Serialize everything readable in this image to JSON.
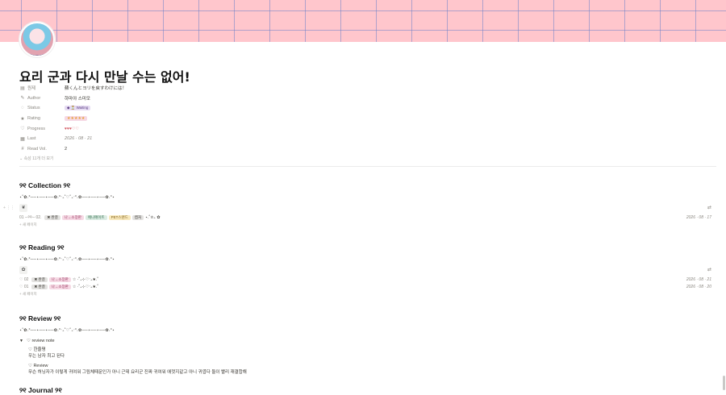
{
  "page": {
    "title": "요리 군과 다시 만날 수는 없어!",
    "properties": [
      {
        "icon": "text-icon",
        "glyph": "▤",
        "key": "원제",
        "value": "蘇くんとヨリを戻すわけには！"
      },
      {
        "icon": "person-icon",
        "glyph": "✎",
        "key": "Author",
        "value": "하마야 스미모"
      },
      {
        "icon": "status-icon",
        "glyph": "◌",
        "key": "Status",
        "tag": "◆ ⏳ Waiting"
      },
      {
        "icon": "star-icon",
        "glyph": "★",
        "key": "Rating",
        "tag": "★★★★★"
      },
      {
        "icon": "heart-icon",
        "glyph": "♡",
        "key": "Progress",
        "value": "♥♥♥♡♡"
      },
      {
        "icon": "calendar-icon",
        "glyph": "▦",
        "key": "Last",
        "value": "2026 · 08 · 21"
      },
      {
        "icon": "hash-icon",
        "glyph": "#",
        "key": "Read Vol.",
        "value": "2"
      }
    ],
    "more_props": "⌄ 속성 11개 더 보기"
  },
  "sections": {
    "collection": {
      "heading": "୨୧ Collection ୨୧",
      "divider": "⋆˚✿˖°──⋆──⋆──✿˖°‧₊˚♡˚₊‧°˖✿──⋆──⋆──✿˖°⋆",
      "view_icon": "❦",
      "view_ctl": "⇄",
      "rows": [
        {
          "name": "01 ─୨୧─ 02.",
          "tags": [
            [
              "✖ 완결",
              "t-gray"
            ],
            [
              "나→소장판",
              "t-pink"
            ],
            [
              "애니메이트",
              "t-green"
            ],
            [
              "PET스탠드",
              "t-yellow"
            ],
            [
              "캡처",
              "t-gray"
            ]
          ],
          "extra": "⋆.˚✮₊ ✿",
          "date": "2026 · 08 · 17"
        }
      ],
      "new": "+  새 페이지"
    },
    "reading": {
      "heading": "୨୧ Reading ୨୧",
      "divider": "⋆˚✿˖°──⋆──⋆──✿˖°‧₊˚♡˚₊‧°˖✿──⋆──⋆──✿˖°⋆",
      "view_icon": "✿",
      "view_ctl": "⇄",
      "rows": [
        {
          "name": "♡ 02",
          "tags": [
            [
              "✖ 완결",
              "t-gray"
            ],
            [
              "나→소장판",
              "t-pink"
            ]
          ],
          "extra": "☆ ·˚₊⊹♡‧₊★.˚",
          "date": "2026 · 08 · 21"
        },
        {
          "name": "♡ 01",
          "tags": [
            [
              "✖ 완결",
              "t-gray"
            ],
            [
              "나→소장판",
              "t-pink"
            ]
          ],
          "extra": "☆ ·˚₊⊹♡‧₊★.˚",
          "date": "2026 · 08 · 20"
        }
      ],
      "new": "+  새 페이지"
    },
    "review": {
      "heading": "୨୧ Review ୨୧",
      "divider": "⋆˚✿˖°──⋆──⋆──✿˖°‧₊˚♡˚₊‧°˖✿──⋆──⋆──✿˖°⋆",
      "toggle": "♡ review note",
      "short_label": "♡ 한줄평",
      "short_text": "우는 남자 최고 된다",
      "long_label": "♡ Review",
      "long_text": "무슨 허닝자가 이렇게 귀여워 그림체때문인가 아니 근데 요리군 진짜 귀여워 애껏지같고 아니 귀엽다 둘이 빨리 재결합해"
    },
    "journal": {
      "heading": "୨୧ Journal ୨୧"
    }
  }
}
